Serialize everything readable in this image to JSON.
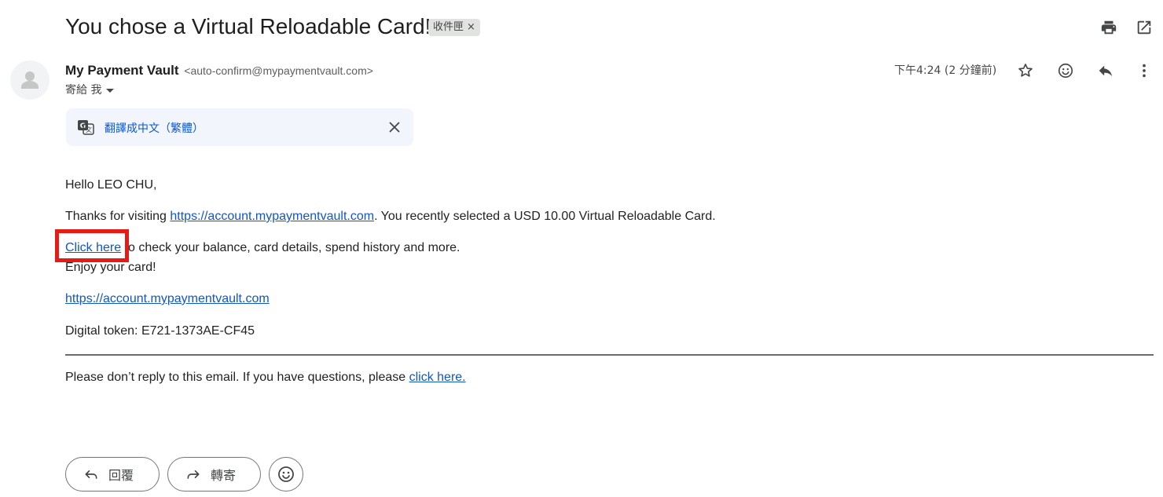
{
  "email": {
    "subject": "You chose a Virtual Reloadable Card!",
    "label": "收件匣",
    "label_remove": "×",
    "sender_name": "My Payment Vault",
    "sender_email": "<auto-confirm@mypaymentvault.com>",
    "recipient": "寄給 我",
    "timestamp": "下午4:24 (2 分鐘前)"
  },
  "translate": {
    "link_text": "翻譯成中文（繁體）"
  },
  "body": {
    "greeting": "Hello LEO CHU,",
    "thanks_prefix": "Thanks for visiting ",
    "thanks_link": "https://account.mypaymentvault.com",
    "thanks_suffix": ". You recently selected a USD 10.00 Virtual Reloadable Card.",
    "click_link": "Click here",
    "click_suffix": " to check your balance, card details, spend history and more.",
    "enjoy": "Enjoy your card!",
    "account_link": "https://account.mypaymentvault.com",
    "token": "Digital token: E721-1373AE-CF45",
    "footer_prefix": "Please don’t reply to this email. If you have questions, please ",
    "footer_link": "click here."
  },
  "actions": {
    "reply_label": "回覆",
    "forward_label": "轉寄"
  },
  "icons": {
    "print": "print-icon",
    "open_new_window": "open-in-new-window-icon",
    "star": "star-icon",
    "emoji": "emoji-icon",
    "reply": "reply-icon",
    "more": "more-vertical-icon",
    "translate": "google-translate-icon",
    "close": "close-icon"
  },
  "colors": {
    "link": "#1155cc",
    "highlight": "#e41b17",
    "translate_bg": "#f2f6fc"
  }
}
